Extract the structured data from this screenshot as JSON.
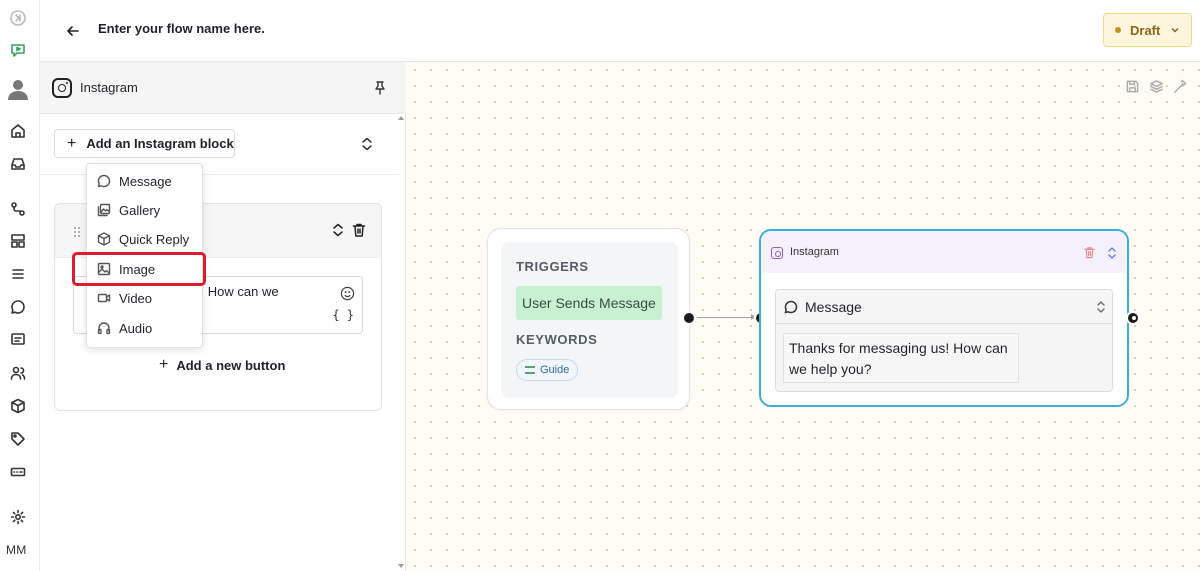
{
  "header": {
    "flow_name": "Enter your flow name here.",
    "status_label": "Draft"
  },
  "rail": {
    "user_initials": "MM",
    "icons": [
      "collapse-icon",
      "logo-icon",
      "avatar-icon",
      "home-icon",
      "inbox-icon",
      "flows-icon",
      "layout-icon",
      "list-icon",
      "chat-icon",
      "messages-icon",
      "contacts-icon",
      "package-icon",
      "tag-icon",
      "keyboard-icon",
      "gear-icon"
    ]
  },
  "panel": {
    "title": "Instagram",
    "add_block_label": "Add an Instagram block",
    "message_preview": "g us! How can we",
    "braces_label": "{ }",
    "add_button_label": "Add a new button"
  },
  "menu": {
    "items": [
      {
        "label": "Message",
        "icon": "message-icon"
      },
      {
        "label": "Gallery",
        "icon": "gallery-icon"
      },
      {
        "label": "Quick Reply",
        "icon": "cube-icon"
      },
      {
        "label": "Image",
        "icon": "image-icon"
      },
      {
        "label": "Video",
        "icon": "video-icon"
      },
      {
        "label": "Audio",
        "icon": "headphones-icon"
      }
    ],
    "highlighted": "Image"
  },
  "canvas": {
    "trigger_node": {
      "triggers_title": "TRIGGERS",
      "trigger_value": "User Sends Message",
      "keywords_title": "KEYWORDS",
      "keyword": "Guide"
    },
    "instagram_node": {
      "title": "Instagram",
      "block_type": "Message",
      "message_text": "Thanks for messaging us! How can we help you?"
    }
  },
  "colors": {
    "draft_bg": "#fdf6dc",
    "highlight": "#e0192b",
    "node_selected_border": "#3ab1d8",
    "trigger_pill": "#c8f1d2"
  }
}
